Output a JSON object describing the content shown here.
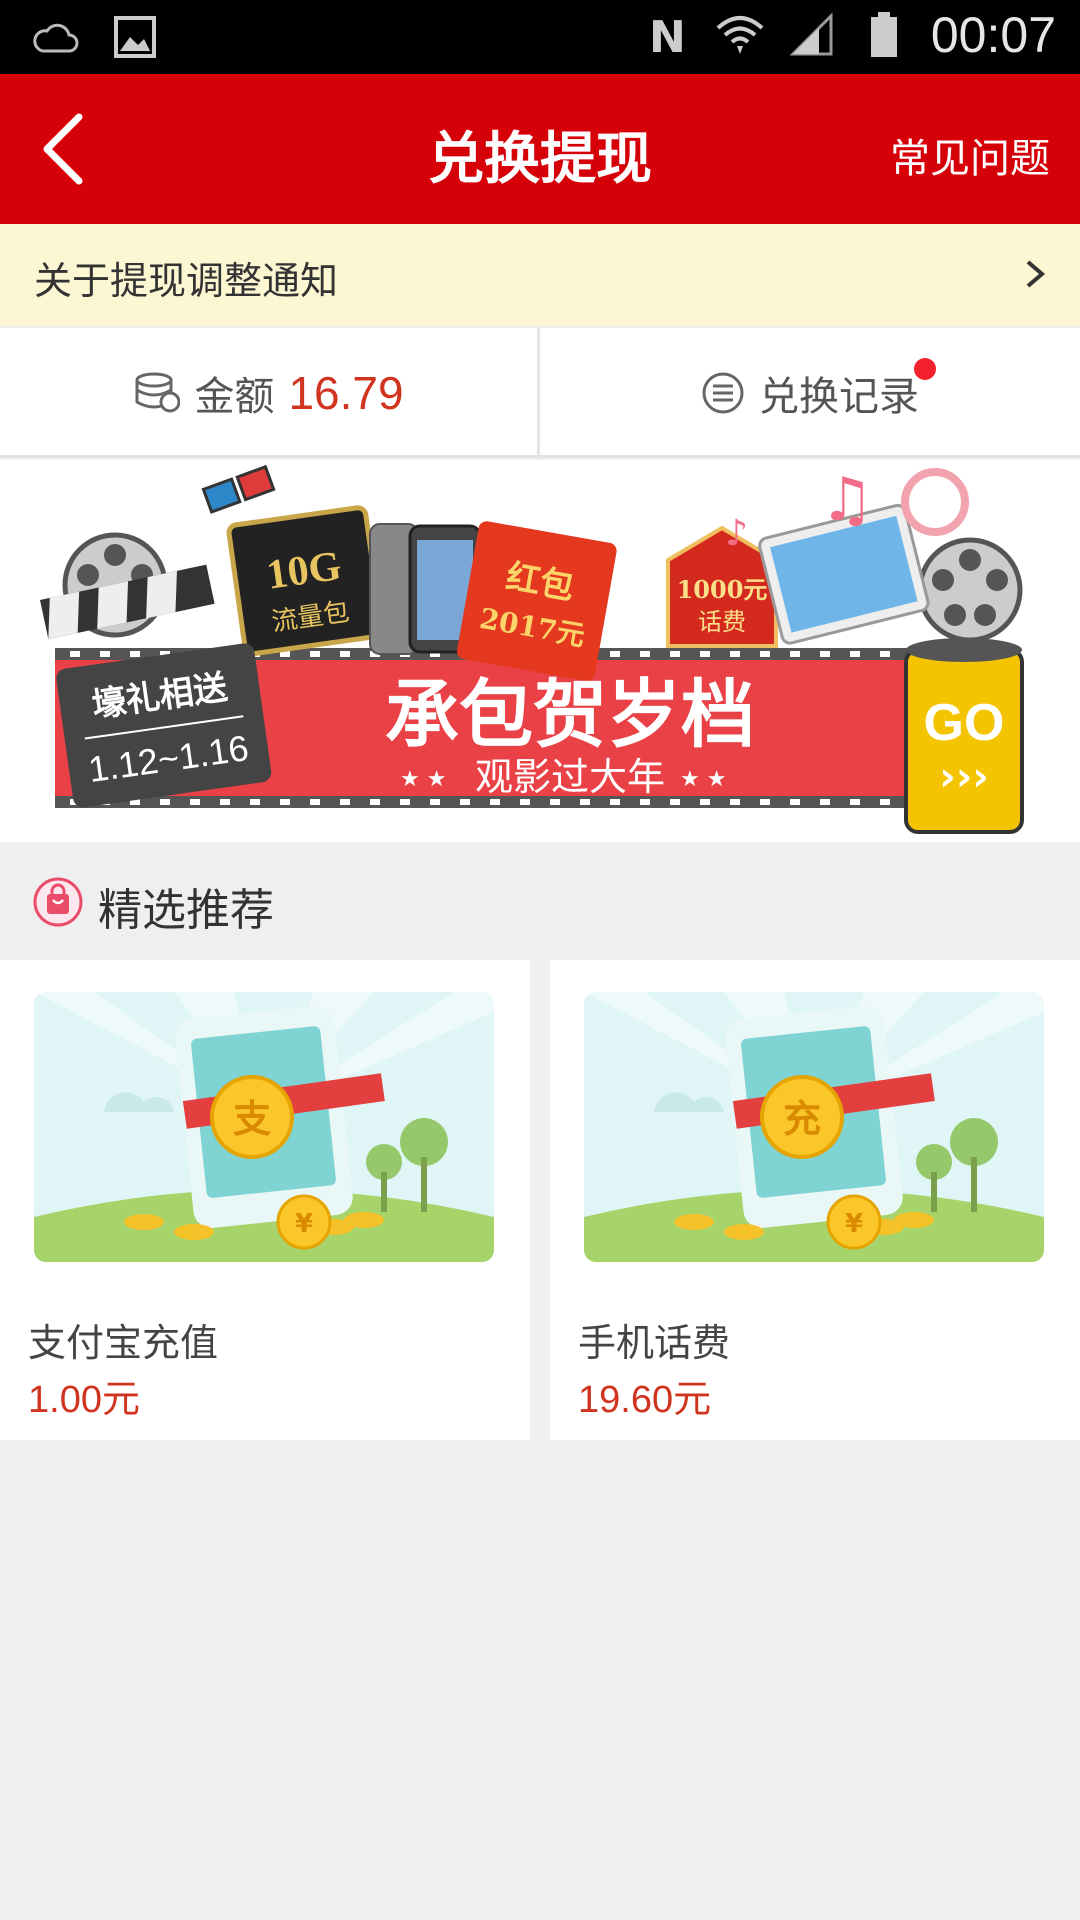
{
  "status_bar": {
    "time": "00:07",
    "icons": [
      "cloud-icon",
      "image-icon",
      "nfc-icon",
      "wifi-icon",
      "signal-icon",
      "battery-icon"
    ]
  },
  "header": {
    "title": "兑换提现",
    "faq_label": "常见问题",
    "back_icon": "chevron-left-icon"
  },
  "notice": {
    "text": "关于提现调整通知"
  },
  "stats": {
    "amount_label": "金额",
    "amount_value": "16.79",
    "records_label": "兑换记录"
  },
  "banner": {
    "badge_top": "壕礼相送",
    "badge_dates": "1.12~1.16",
    "headline": "承包贺岁档",
    "subline": "观影过大年",
    "go_label": "GO",
    "item_data": "10G",
    "item_data_sub": "流量包",
    "item_envelope": "红包",
    "item_envelope_year": "2017元",
    "item_bill": "1000元",
    "item_bill_sub": "话费"
  },
  "section": {
    "title": "精选推荐",
    "icon": "shopping-bag-icon"
  },
  "products": [
    {
      "name": "支付宝充值",
      "price": "1.00元",
      "coin_char": "支"
    },
    {
      "name": "手机话费",
      "price": "19.60元",
      "coin_char": "充"
    }
  ],
  "colors": {
    "brand_red": "#d60008",
    "price_red": "#d0341f",
    "notice_bg": "#fdf6d3",
    "page_bg": "#efefef"
  }
}
